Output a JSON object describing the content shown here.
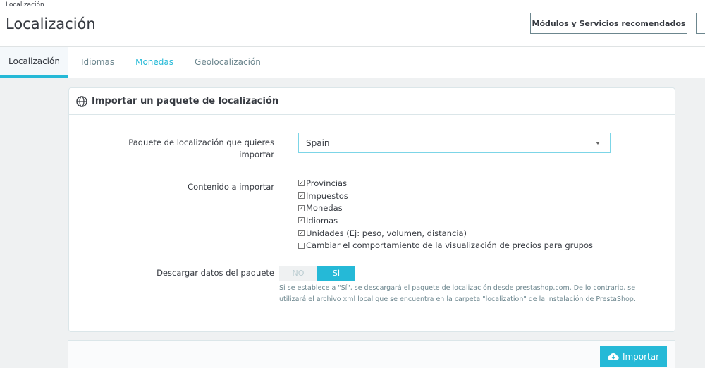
{
  "header": {
    "breadcrumb": "Localización",
    "title": "Localización",
    "buttons": [
      "Módulos y Servicios recomendados"
    ]
  },
  "tabs": [
    {
      "label": "Localización"
    },
    {
      "label": "Idiomas"
    },
    {
      "label": "Monedas"
    },
    {
      "label": "Geolocalización"
    }
  ],
  "panel": {
    "title": "Importar un paquete de localización",
    "package_label": "Paquete de localización que quieres importar",
    "package_value": "Spain",
    "content_label": "Contenido a importar",
    "content_items": [
      {
        "label": "Provincias",
        "checked": true
      },
      {
        "label": "Impuestos",
        "checked": true
      },
      {
        "label": "Monedas",
        "checked": true
      },
      {
        "label": "Idiomas",
        "checked": true
      },
      {
        "label": "Unidades (Ej: peso, volumen, distancia)",
        "checked": true
      },
      {
        "label": "Cambiar el comportamiento de la visualización de precios para grupos",
        "checked": false
      }
    ],
    "download_label": "Descargar datos del paquete",
    "switch_no": "NO",
    "switch_yes": "SÍ",
    "switch_value": "SÍ",
    "help": "Si se establece a \"Sí\", se descargará el paquete de localización desde prestashop.com. De lo contrario, se utilizará el archivo xml local que se encuentra en la carpeta \"localization\" de la instalación de PrestaShop."
  },
  "footer": {
    "import_label": "Importar"
  }
}
